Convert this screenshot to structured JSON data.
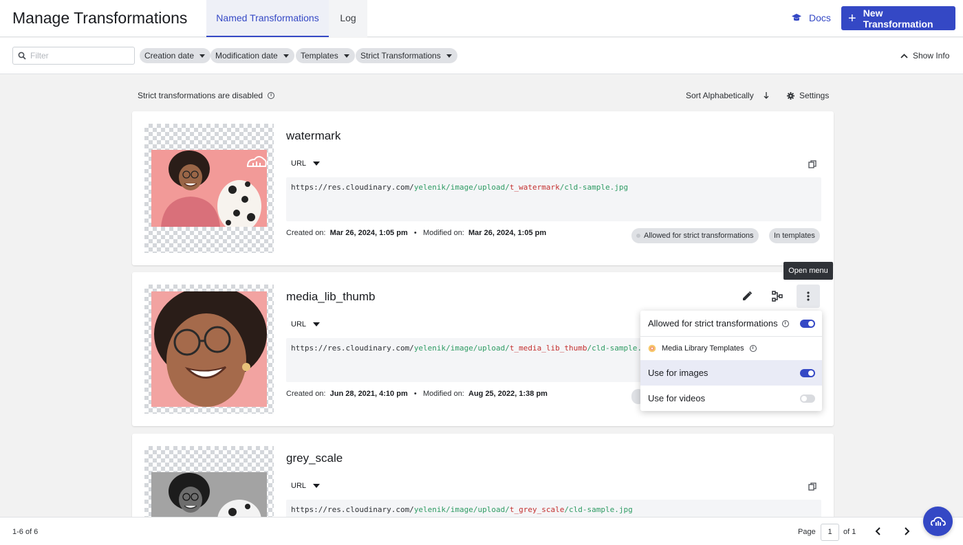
{
  "header": {
    "title": "Manage Transformations",
    "tabs": [
      {
        "label": "Named Transformations",
        "active": true
      },
      {
        "label": "Log",
        "active": false
      }
    ],
    "docs_label": "Docs",
    "docs_icon": "graduation-cap-icon",
    "new_button_label": "New Transformation"
  },
  "filters": {
    "search_placeholder": "Filter",
    "chips": [
      "Creation date",
      "Modification date",
      "Templates",
      "Strict Transformations"
    ],
    "show_info_label": "Show Info"
  },
  "toolbar": {
    "strict_note": "Strict transformations are disabled",
    "sort_label": "Sort Alphabetically",
    "settings_label": "Settings"
  },
  "cards": [
    {
      "name": "watermark",
      "url_type": "URL",
      "url": {
        "base": "https://res.cloudinary.com/",
        "path": "yelenik/image/upload/",
        "transformation": "t_watermark",
        "slash": "/",
        "file": "cld-sample.jpg"
      },
      "created_label": "Created on:",
      "created": "Mar 26, 2024, 1:05 pm",
      "separator": "•",
      "modified_label": "Modified on:",
      "modified": "Mar 26, 2024, 1:05 pm",
      "badges": [
        "Allowed for strict transformations",
        "In templates"
      ]
    },
    {
      "name": "media_lib_thumb",
      "url_type": "URL",
      "url": {
        "base": "https://res.cloudinary.com/",
        "path": "yelenik/image/upload/",
        "transformation": "t_media_lib_thumb",
        "slash": "/",
        "file": "cld-sample.jpg"
      },
      "created_label": "Created on:",
      "created": "Jun 28, 2021, 4:10 pm",
      "separator": "•",
      "modified_label": "Modified on:",
      "modified": "Aug 25, 2022, 1:38 pm"
    },
    {
      "name": "grey_scale",
      "url_type": "URL",
      "url": {
        "base": "https://res.cloudinary.com/",
        "path": "yelenik/image/upload/",
        "transformation": "t_grey_scale",
        "slash": "/",
        "file": "cld-sample.jpg"
      }
    }
  ],
  "tooltip": "Open menu",
  "menu": {
    "strict_label": "Allowed for strict transformations",
    "strict_on": true,
    "section_label": "Media Library Templates",
    "images_label": "Use for images",
    "images_on": true,
    "videos_label": "Use for videos",
    "videos_on": false
  },
  "footer": {
    "count": "1-6 of 6",
    "page_label": "Page",
    "page_value": "1",
    "page_of": "of 1"
  },
  "colors": {
    "accent": "#3448c5",
    "url_path": "#2e9b63",
    "url_transformation": "#c4302f"
  }
}
